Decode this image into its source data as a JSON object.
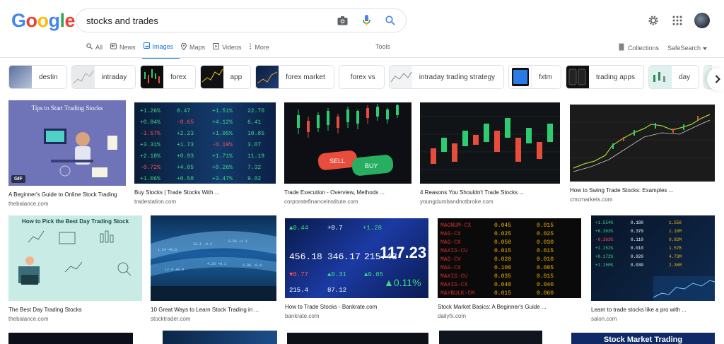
{
  "search": {
    "query": "stocks and trades"
  },
  "nav": {
    "tabs": [
      {
        "label": "All",
        "icon": "search-icon"
      },
      {
        "label": "News",
        "icon": "news-icon"
      },
      {
        "label": "Images",
        "icon": "image-icon"
      },
      {
        "label": "Maps",
        "icon": "map-pin-icon"
      },
      {
        "label": "Videos",
        "icon": "video-icon"
      },
      {
        "label": "More",
        "icon": "more-vert-icon"
      }
    ],
    "tools": "Tools",
    "collections": "Collections",
    "safesearch": "SafeSearch"
  },
  "chips": [
    {
      "label": "destin"
    },
    {
      "label": "intraday"
    },
    {
      "label": "forex"
    },
    {
      "label": "app"
    },
    {
      "label": "forex market"
    },
    {
      "label": "forex vs"
    },
    {
      "label": "intraday trading strategy"
    },
    {
      "label": "fxtm"
    },
    {
      "label": "trading apps"
    },
    {
      "label": "day"
    },
    {
      "label": "day"
    }
  ],
  "results": [
    {
      "title": "A Beginner's Guide to Online Stock Trading",
      "source": "thebalance.com",
      "overlay": "Tips to Start Trading Stocks",
      "badge": "GIF"
    },
    {
      "title": "Buy Stocks | Trade Stocks With ...",
      "source": "tradestation.com"
    },
    {
      "title": "Trade Execution - Overview, Methods ...",
      "source": "corporatefinanceinstitute.com",
      "sell": "SELL",
      "buy": "BUY"
    },
    {
      "title": "4 Reasons You Shouldn't Trade Stocks ...",
      "source": "youngdumbandnotbroke.com"
    },
    {
      "title": "How to Swing Trade Stocks: Examples ...",
      "source": "cmcmarkets.com"
    },
    {
      "title": "The Best Day Trading Stocks",
      "source": "thebalance.com",
      "overlay": "How to Pick the Best Day Trading Stock"
    },
    {
      "title": "10 Great Ways to Learn Stock Trading in ...",
      "source": "stocktrader.com"
    },
    {
      "title": "How to Trade Stocks - Bankrate.com",
      "source": "bankrate.com",
      "big": "117.23"
    },
    {
      "title": "Stock Market Basics: A Beginner's Guide ...",
      "source": "dailyfx.com"
    },
    {
      "title": "Learn to trade stocks like a pro with ...",
      "source": "salon.com"
    }
  ],
  "bottom_row": {
    "partial_title": "Stock Market Trading"
  }
}
